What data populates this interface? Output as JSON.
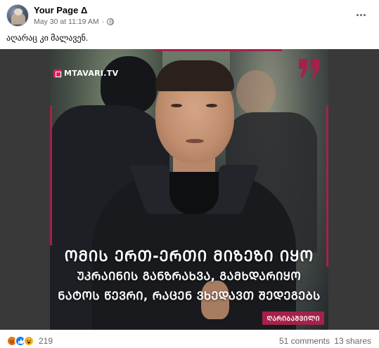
{
  "post": {
    "page_name": "Your Page Δ",
    "date": "May 30 at 11:19 AM",
    "separator": "·",
    "caption": "აღარაც კი მალავენ."
  },
  "image": {
    "logo_text": "MTAVARI.TV",
    "headline": [
      "ᲝᲛᲘᲡ ᲔᲠᲗ-ᲔᲠᲗᲘ ᲛᲘᲖᲔᲖᲘ ᲘᲧᲝ",
      "ᲣᲙᲠᲐᲘᲜᲘᲡ ᲒᲐᲜᲖᲠᲐᲮᲕᲐ, ᲒᲐᲛᲮᲓᲐᲠᲘᲧᲝ",
      "ᲜᲐᲢᲝᲡ ᲬᲔᲕᲠᲘ, ᲠᲐᲪᲔᲜ ᲕᲮᲔᲓᲐᲕᲗ ᲨᲔᲓᲔᲒᲔᲑᲡ"
    ],
    "speaker_tag": "ᲦᲐᲠᲘᲑᲐᲨᲕᲘᲚᲘ",
    "accent_color": "#a4224a",
    "quote_icon": "quote-icon"
  },
  "footer": {
    "reaction_icons": [
      "angry-icon",
      "like-icon",
      "haha-icon"
    ],
    "reaction_count": "219",
    "comments": "51 comments",
    "shares": "13 shares"
  }
}
